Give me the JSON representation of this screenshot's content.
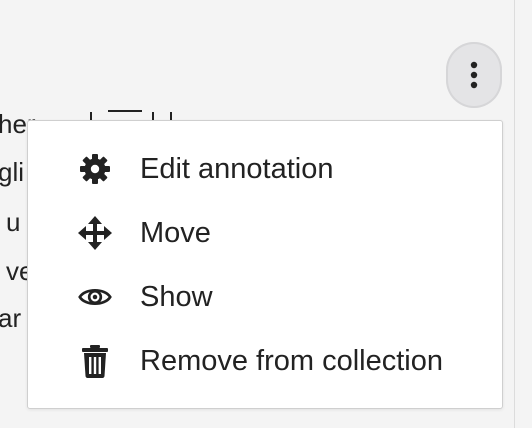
{
  "background_text": [
    "her",
    "gli",
    "u",
    "ve",
    "ar"
  ],
  "menu_button": {
    "icon": "kebab-vertical-icon"
  },
  "menu": {
    "items": [
      {
        "label": "Edit annotation",
        "icon": "gear-icon"
      },
      {
        "label": "Move",
        "icon": "move-arrows-icon"
      },
      {
        "label": "Show",
        "icon": "eye-icon"
      },
      {
        "label": "Remove from collection",
        "icon": "trash-icon"
      }
    ]
  },
  "colors": {
    "text": "#222222",
    "menu_bg": "#ffffff",
    "page_bg": "#f4f4f4"
  }
}
